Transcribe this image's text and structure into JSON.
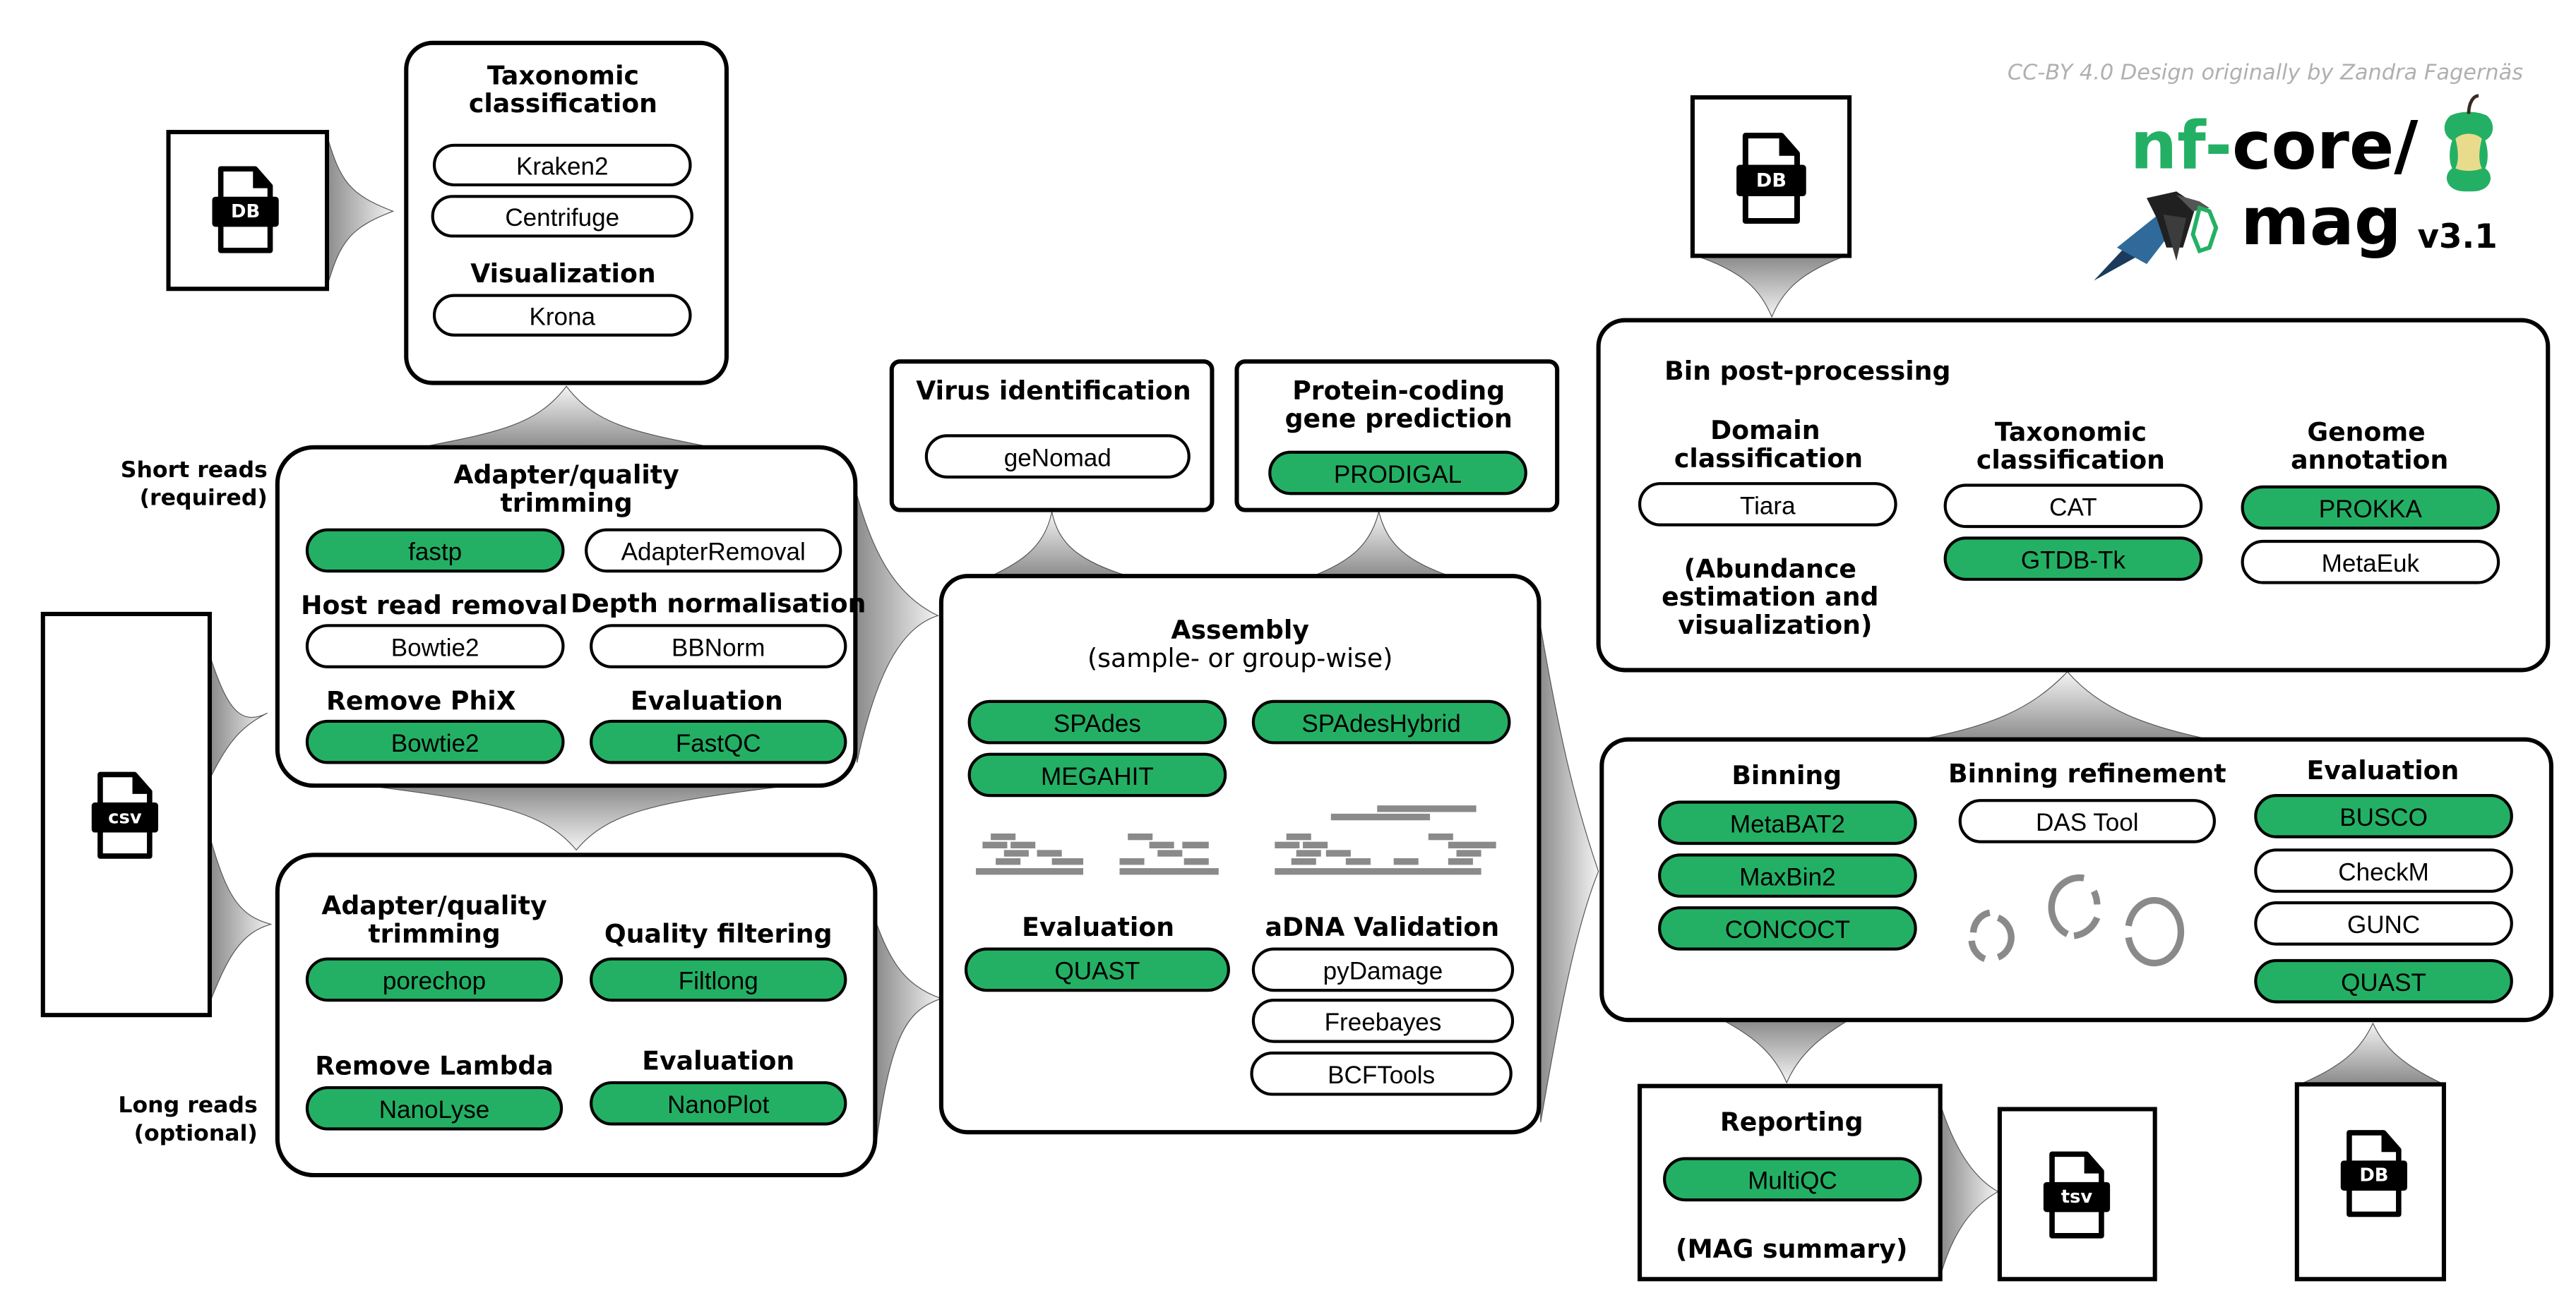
{
  "credit": "CC-BY 4.0 Design originally by Zandra Fagernäs",
  "logo": {
    "prefix": "nf-",
    "core": "core/",
    "name": "mag",
    "version": "v3.1",
    "brand_green": "#24B064",
    "icons": [
      "apple-core-icon",
      "magpie-icon"
    ]
  },
  "colors": {
    "default_tool": "#24B064",
    "optional_tool": "#ffffff",
    "connector_dark": "#8c8c8c",
    "connector_light": "#f2f2f2"
  },
  "inputs": {
    "csv_label": "csv",
    "short_reads_label": [
      "Short reads",
      "(required)"
    ],
    "long_reads_label": [
      "Long reads",
      "(optional)"
    ]
  },
  "files": {
    "kraken_db": "DB",
    "gtdb_db": "DB",
    "busco_db": "DB",
    "summary_tsv": "tsv"
  },
  "taxonomic_classification": {
    "title": [
      "Taxonomic",
      "classification"
    ],
    "tools": [
      {
        "label": "Kraken2",
        "default": false
      },
      {
        "label": "Centrifuge",
        "default": false
      }
    ],
    "visualization_title": "Visualization",
    "visualization_tools": [
      {
        "label": "Krona",
        "default": false
      }
    ]
  },
  "short_reads": {
    "trimming_title": [
      "Adapter/quality",
      "trimming"
    ],
    "trimming_tools": [
      {
        "label": "fastp",
        "default": true
      },
      {
        "label": "AdapterRemoval",
        "default": false
      }
    ],
    "host_title": "Host read removal",
    "host_tools": [
      {
        "label": "Bowtie2",
        "default": false
      }
    ],
    "depth_title": "Depth normalisation",
    "depth_tools": [
      {
        "label": "BBNorm",
        "default": false
      }
    ],
    "phix_title": "Remove PhiX",
    "phix_tools": [
      {
        "label": "Bowtie2",
        "default": true
      }
    ],
    "eval_title": "Evaluation",
    "eval_tools": [
      {
        "label": "FastQC",
        "default": true
      }
    ]
  },
  "long_reads": {
    "trimming_title": [
      "Adapter/quality",
      "trimming"
    ],
    "trimming_tools": [
      {
        "label": "porechop",
        "default": true
      }
    ],
    "filter_title": "Quality filtering",
    "filter_tools": [
      {
        "label": "Filtlong",
        "default": true
      }
    ],
    "lambda_title": "Remove Lambda",
    "lambda_tools": [
      {
        "label": "NanoLyse",
        "default": true
      }
    ],
    "eval_title": "Evaluation",
    "eval_tools": [
      {
        "label": "NanoPlot",
        "default": true
      }
    ]
  },
  "virus_identification": {
    "title": "Virus identification",
    "tools": [
      {
        "label": "geNomad",
        "default": false
      }
    ]
  },
  "protein_prediction": {
    "title": [
      "Protein-coding",
      "gene prediction"
    ],
    "tools": [
      {
        "label": "PRODIGAL",
        "default": true
      }
    ]
  },
  "assembly": {
    "title": "Assembly",
    "subtitle": "(sample- or group-wise)",
    "tools": [
      {
        "label": "SPAdes",
        "default": true
      },
      {
        "label": "SPAdesHybrid",
        "default": true
      },
      {
        "label": "MEGAHIT",
        "default": true
      }
    ],
    "eval_title": "Evaluation",
    "eval_tools": [
      {
        "label": "QUAST",
        "default": true
      }
    ],
    "adna_title": "aDNA Validation",
    "adna_tools": [
      {
        "label": "pyDamage",
        "default": false
      },
      {
        "label": "Freebayes",
        "default": false
      },
      {
        "label": "BCFTools",
        "default": false
      }
    ]
  },
  "bin_postprocessing": {
    "title": "Bin post-processing",
    "domain_title": [
      "Domain",
      "classification"
    ],
    "domain_tools": [
      {
        "label": "Tiara",
        "default": false
      }
    ],
    "abundance_note": [
      "(Abundance",
      "estimation and",
      "visualization)"
    ],
    "taxonomy_title": [
      "Taxonomic",
      "classification"
    ],
    "taxonomy_tools": [
      {
        "label": "CAT",
        "default": false
      },
      {
        "label": "GTDB-Tk",
        "default": true
      }
    ],
    "annotation_title": [
      "Genome",
      "annotation"
    ],
    "annotation_tools": [
      {
        "label": "PROKKA",
        "default": true
      },
      {
        "label": "MetaEuk",
        "default": false
      }
    ]
  },
  "binning": {
    "binning_title": "Binning",
    "binning_tools": [
      {
        "label": "MetaBAT2",
        "default": true
      },
      {
        "label": "MaxBin2",
        "default": true
      },
      {
        "label": "CONCOCT",
        "default": true
      }
    ],
    "refinement_title": "Binning refinement",
    "refinement_tools": [
      {
        "label": "DAS Tool",
        "default": false
      }
    ],
    "eval_title": "Evaluation",
    "eval_tools": [
      {
        "label": "BUSCO",
        "default": true
      },
      {
        "label": "CheckM",
        "default": false
      },
      {
        "label": "GUNC",
        "default": false
      },
      {
        "label": "QUAST",
        "default": true
      }
    ]
  },
  "reporting": {
    "title": "Reporting",
    "tools": [
      {
        "label": "MultiQC",
        "default": true
      }
    ],
    "note": "(MAG summary)"
  }
}
